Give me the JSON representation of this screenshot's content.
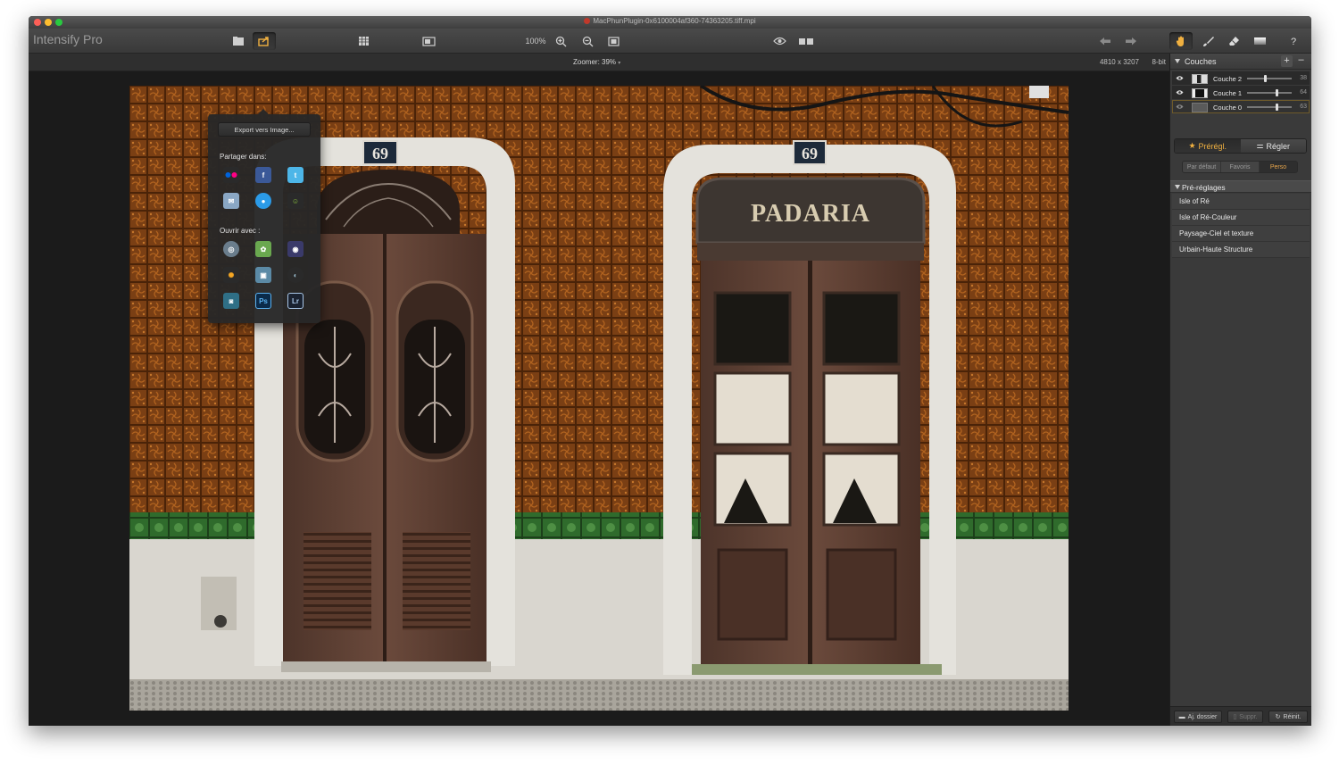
{
  "window": {
    "title": "MacPhunPlugin-0x6100004af360-74363205.tiff.mpi",
    "app_name": "Intensify Pro",
    "traffic_colors": [
      "#fc5f57",
      "#fdbd2f",
      "#29c940"
    ]
  },
  "toolbar": {
    "zoom_percent": "100%",
    "icons": [
      "open-file-icon",
      "share-icon",
      "grid-icon",
      "compare-icon",
      "zoom-in-icon",
      "zoom-out-icon",
      "fit-icon",
      "preview-eye-icon",
      "split-view-icon",
      "undo-icon",
      "redo-icon",
      "hand-icon",
      "brush-icon",
      "eraser-icon",
      "gradient-icon",
      "help-icon"
    ]
  },
  "infobar": {
    "zoom_label": "Zoomer:",
    "zoom_value": "39%",
    "image_dims": "4810 x 3207",
    "bit_depth": "8-bit"
  },
  "photo": {
    "sign_text": "PADARIA",
    "left_number": "69",
    "right_number": "69"
  },
  "share_popover": {
    "export_label": "Export vers Image...",
    "share_heading": "Partager dans:",
    "open_heading": "Ouvrir avec :",
    "share_icons": [
      "flickr-icon",
      "facebook-icon",
      "twitter-icon",
      "email-icon",
      "messages-icon",
      "smugmug-icon"
    ],
    "open_icons": [
      "aperture-icon",
      "iphoto-icon",
      "tonality-icon",
      "photos-icon",
      "preview-icon",
      "colorsync-icon",
      "photoshop-elements-icon",
      "photoshop-icon",
      "lightroom-icon"
    ],
    "ps_text": "Ps",
    "lr_text": "Lr"
  },
  "layers": {
    "title": "Couches",
    "add_symbol": "+",
    "remove_symbol": "–",
    "items": [
      {
        "name": "Couche 2",
        "value": "38",
        "opacity": 0.38
      },
      {
        "name": "Couche 1",
        "value": "64",
        "opacity": 0.64
      },
      {
        "name": "Couche 0",
        "value": "63",
        "opacity": 0.63
      }
    ]
  },
  "mode_tabs": {
    "presets": "Prérégl.",
    "adjust": "Régler"
  },
  "sub_tabs": {
    "default": "Par défaut",
    "favorites": "Favoris",
    "custom": "Perso"
  },
  "presets": {
    "title": "Pré-réglages",
    "items": [
      "Isle of Ré",
      "Isle of Ré-Couleur",
      "Paysage-Ciel et texture",
      "Urbain-Haute Structure"
    ]
  },
  "bottom_bar": {
    "add_folder": "Aj. dossier",
    "delete": "Suppr.",
    "reset": "Réinit."
  },
  "colors": {
    "accent": "#e7a54b",
    "panel": "#3a3a3a",
    "canvas": "#1b1b1b"
  }
}
